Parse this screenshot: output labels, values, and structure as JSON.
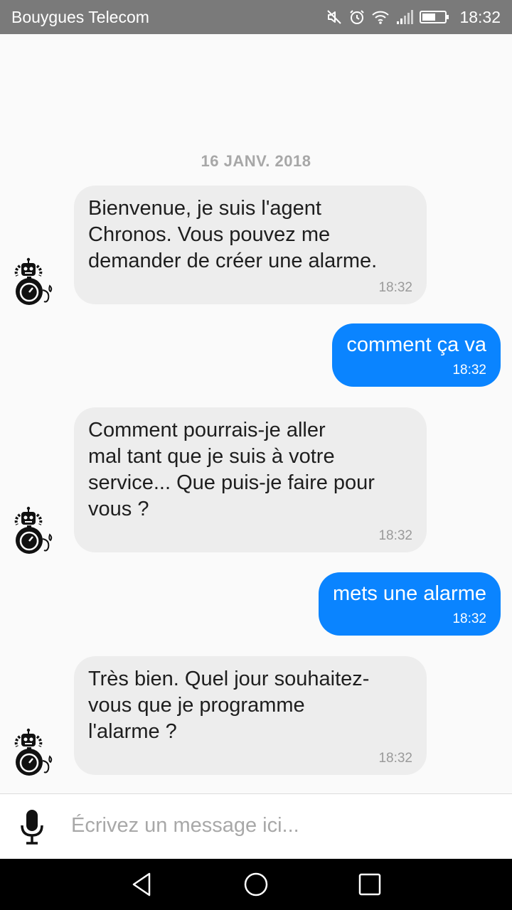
{
  "status_bar": {
    "carrier": "Bouygues Telecom",
    "time": "18:32",
    "icons": [
      "mute-icon",
      "alarm-icon",
      "wifi-icon",
      "signal-icon",
      "battery-icon"
    ]
  },
  "chat": {
    "date_separator": "16 JANV. 2018",
    "messages": [
      {
        "from": "bot",
        "text": "Bienvenue, je suis l'agent\nChronos. Vous pouvez me\ndemander de créer une alarme.",
        "time": "18:32"
      },
      {
        "from": "user",
        "text": "comment ça va",
        "time": "18:32"
      },
      {
        "from": "bot",
        "text": "Comment pourrais-je aller\nmal tant que je suis à votre\nservice... Que puis-je faire pour\nvous ?",
        "time": "18:32"
      },
      {
        "from": "user",
        "text": "mets une alarme",
        "time": "18:32"
      },
      {
        "from": "bot",
        "text": "Très bien. Quel jour souhaitez-\nvous que je programme\nl'alarme ?",
        "time": "18:32"
      }
    ]
  },
  "composer": {
    "placeholder": "Écrivez un message ici...",
    "value": ""
  },
  "colors": {
    "user_bubble": "#0a84ff",
    "bot_bubble": "#ededed",
    "status_bar": "#7a7a7a"
  }
}
